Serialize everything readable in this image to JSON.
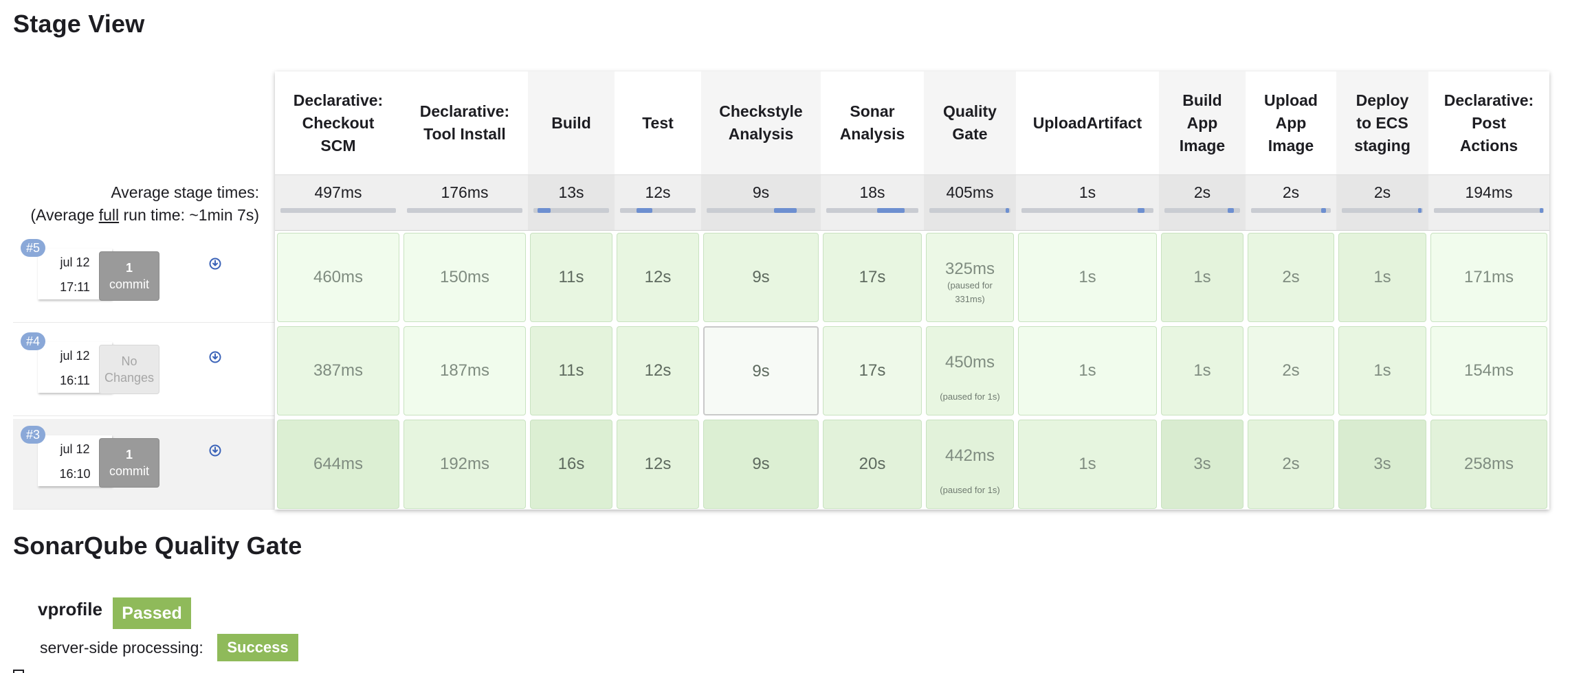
{
  "page": {
    "stage_view_title": "Stage View",
    "sonar_title": "SonarQube Quality Gate"
  },
  "averages": {
    "label_line1": "Average stage times:",
    "label_line2_prefix": "(Average ",
    "label_line2_link": "full",
    "label_line2_suffix": " run time: ~1min 7s)"
  },
  "stages": [
    {
      "name_lines": [
        "Declarative:",
        "Checkout",
        "SCM"
      ],
      "avg": "497ms"
    },
    {
      "name_lines": [
        "Declarative:",
        "Tool Install"
      ],
      "avg": "176ms"
    },
    {
      "name_lines": [
        "Build"
      ],
      "avg": "13s"
    },
    {
      "name_lines": [
        "Test"
      ],
      "avg": "12s"
    },
    {
      "name_lines": [
        "Checkstyle",
        "Analysis"
      ],
      "avg": "9s"
    },
    {
      "name_lines": [
        "Sonar",
        "Analysis"
      ],
      "avg": "18s"
    },
    {
      "name_lines": [
        "Quality",
        "Gate"
      ],
      "avg": "405ms"
    },
    {
      "name_lines": [
        "UploadArtifact"
      ],
      "avg": "1s"
    },
    {
      "name_lines": [
        "Build",
        "App",
        "Image"
      ],
      "avg": "2s"
    },
    {
      "name_lines": [
        "Upload",
        "App",
        "Image"
      ],
      "avg": "2s"
    },
    {
      "name_lines": [
        "Deploy",
        "to ECS",
        "staging"
      ],
      "avg": "2s"
    },
    {
      "name_lines": [
        "Declarative:",
        "Post",
        "Actions"
      ],
      "avg": "194ms"
    }
  ],
  "builds": [
    {
      "number": "#5",
      "date": "jul 12",
      "time": "17:11",
      "commits": {
        "has_changes": true,
        "count": "1",
        "word": "commit"
      },
      "cells": [
        "460ms",
        "150ms",
        "11s",
        "12s",
        "9s",
        "17s",
        "325ms",
        "1s",
        "1s",
        "2s",
        "1s",
        "171ms"
      ],
      "paused": {
        "6": [
          "(paused for",
          "331ms)"
        ]
      }
    },
    {
      "number": "#4",
      "date": "jul 12",
      "time": "16:11",
      "commits": {
        "has_changes": false,
        "line1": "No",
        "line2": "Changes"
      },
      "cells": [
        "387ms",
        "187ms",
        "11s",
        "12s",
        "9s",
        "17s",
        "450ms",
        "1s",
        "1s",
        "2s",
        "1s",
        "154ms"
      ],
      "paused": {
        "6": [
          "(paused for 1s)"
        ]
      }
    },
    {
      "number": "#3",
      "date": "jul 12",
      "time": "16:10",
      "commits": {
        "has_changes": true,
        "count": "1",
        "word": "commit"
      },
      "cells": [
        "644ms",
        "192ms",
        "16s",
        "12s",
        "9s",
        "20s",
        "442ms",
        "1s",
        "3s",
        "2s",
        "3s",
        "258ms"
      ],
      "paused": {
        "6": [
          "(paused for 1s)"
        ]
      }
    }
  ],
  "sonar": {
    "project": "vprofile",
    "status": "Passed",
    "server_label": "server-side processing:",
    "server_status": "Success",
    "badge_color": "#8fba5a"
  },
  "colors": {
    "stage_success_light": "#f1fced",
    "stage_success_mid": "#e6f6df",
    "stage_success_dark": "#dcefd3",
    "bar_fill": "#6d8fd0",
    "build_badge": "#8aa8d8"
  },
  "icons": {
    "download": "download-circle-icon"
  }
}
